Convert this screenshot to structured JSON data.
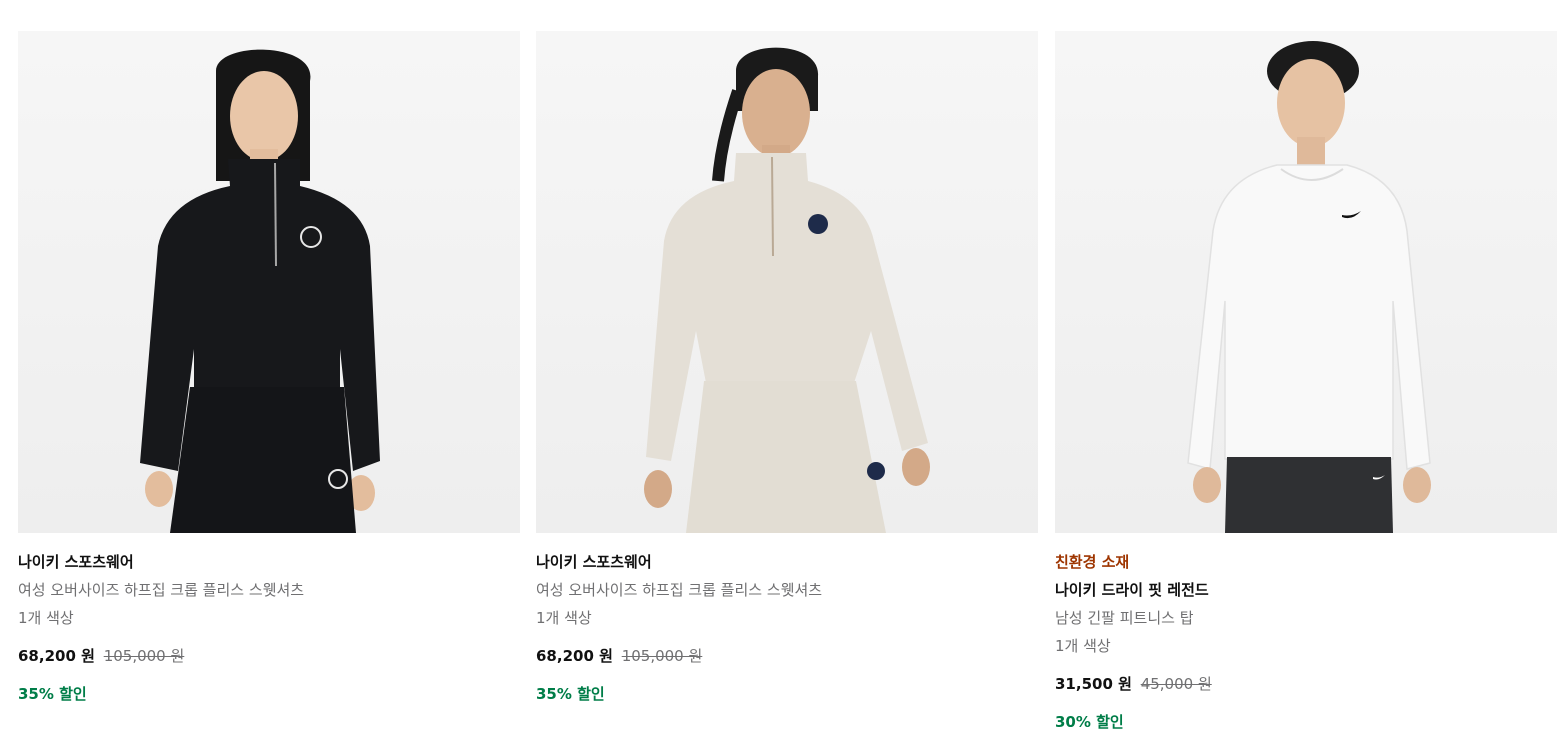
{
  "products": [
    {
      "tag": "",
      "title": "나이키 스포츠웨어",
      "subtitle": "여성 오버사이즈 하프집 크롭 플리스 스웻셔츠",
      "colors": "1개 색상",
      "price_sale": "68,200 원",
      "price_original": "105,000 원",
      "discount": "35% 할인",
      "garment_color": "#17181b",
      "image_icon": "product-photo-black-half-zip"
    },
    {
      "tag": "",
      "title": "나이키 스포츠웨어",
      "subtitle": "여성 오버사이즈 하프집 크롭 플리스 스웻셔츠",
      "colors": "1개 색상",
      "price_sale": "68,200 원",
      "price_original": "105,000 원",
      "discount": "35% 할인",
      "garment_color": "#e4dfd6",
      "image_icon": "product-photo-oatmeal-half-zip"
    },
    {
      "tag": "친환경 소재",
      "title": "나이키 드라이 핏 레전드",
      "subtitle": "남성 긴팔 피트니스 탑",
      "colors": "1개 색상",
      "price_sale": "31,500 원",
      "price_original": "45,000 원",
      "discount": "30% 할인",
      "garment_color": "#f7f7f7",
      "image_icon": "product-photo-white-long-sleeve"
    }
  ],
  "colors": {
    "tag": "#9e3500",
    "discount": "#007d48",
    "muted_text": "#707072",
    "image_bg": "#f2f2f2"
  }
}
